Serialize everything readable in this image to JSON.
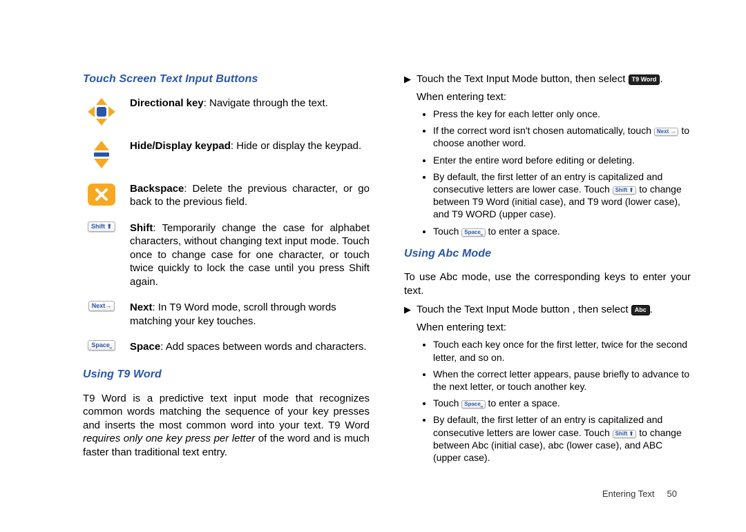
{
  "left": {
    "heading1": "Touch Screen Text Input Buttons",
    "items": [
      {
        "label": "Directional key",
        "desc": ": Navigate through the text."
      },
      {
        "label": "Hide/Display keypad",
        "desc": ": Hide or display the keypad."
      },
      {
        "label": "Backspace",
        "desc": ": Delete the previous character, or go back to the previous field."
      },
      {
        "label": "Shift",
        "desc": ": Temporarily change the case for alphabet characters, without changing text input mode. Touch once to change case for one character, or touch twice quickly to lock  the case until you press Shift again."
      },
      {
        "label": "Next",
        "desc": ": In T9 Word mode, scroll through words matching your key touches."
      },
      {
        "label": "Space",
        "desc": ": Add spaces between words and characters."
      }
    ],
    "heading2": "Using T9 Word",
    "t9_para_pre": "T9 Word is a predictive text input mode that recognizes common words matching the sequence of your key presses and inserts the most common word into your text.  T9 Word ",
    "t9_para_em": "requires only one key press per letter",
    "t9_para_post": " of the word and is much faster than traditional text entry."
  },
  "keys": {
    "shift": "Shift ⬆",
    "next": "Next",
    "space": "Space",
    "t9word": "T9 Word",
    "abc": "Abc"
  },
  "right": {
    "step1_pre": "Touch the Text Input Mode button, then select ",
    "step1_post": ".",
    "when": "When entering text:",
    "t9_bullets": {
      "b1": "Press the key for each letter only once.",
      "b2_pre": "If the correct word isn't chosen automatically, touch ",
      "b2_post": " to choose another word.",
      "b3": "Enter the entire word before editing or deleting.",
      "b4_pre": "By default, the first letter of an entry is capitalized and consecutive letters are lower case. Touch ",
      "b4_post": " to change between T9 Word (initial case), and T9 word (lower case), and T9 WORD (upper case).",
      "b5_pre": "Touch ",
      "b5_post": " to enter a space."
    },
    "heading_abc": "Using Abc Mode",
    "abc_intro": "To use Abc mode, use the corresponding keys to enter your text.",
    "abc_step_pre": "Touch the Text Input Mode button , then select ",
    "abc_step_post": ".",
    "abc_bullets": {
      "b1": "Touch each key once for the first letter, twice for the second letter, and so on.",
      "b2": "When the correct letter appears, pause briefly to advance to the next letter, or touch another key.",
      "b3_pre": "Touch ",
      "b3_post": " to enter a space.",
      "b4_pre": "By default, the first letter of an entry is capitalized and consecutive letters are lower case. Touch ",
      "b4_post": " to change between Abc (initial case), abc (lower case), and ABC (upper case)."
    }
  },
  "footer": {
    "section": "Entering Text",
    "page": "50"
  }
}
